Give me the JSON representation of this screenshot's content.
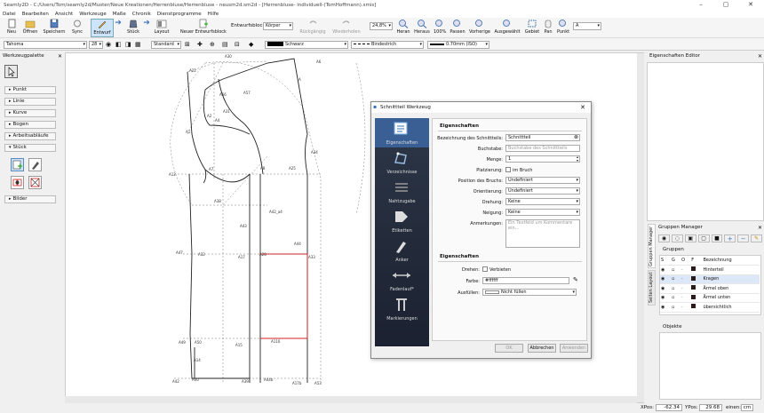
{
  "window": {
    "title": "Seamly2D - C:/Users/Tom/seamly2d/Muster/Neue Kreationen/Herrenbluse/Herrenbluse - neusm2d.sm2d - [Herrenbluse- individuell-(TomHoffmann).smis]",
    "controls": [
      "–",
      "▢",
      "✕"
    ]
  },
  "menu": [
    "Datei",
    "Bearbeiten",
    "Ansicht",
    "Werkzeuge",
    "Maße",
    "Chronik",
    "Dienstprogramme",
    "Hilfe"
  ],
  "toolbar": {
    "neu": "Neu",
    "oeffnen": "Öffnen",
    "speichern": "Speichern",
    "sync": "Sync",
    "entwurf": "Entwurf",
    "stueck": "Stück",
    "layout": "Layout",
    "neuer_entwurf": "Neuer Entwurfsblock",
    "entwurfsblock_label": "Entwurfsblock:",
    "entwurfsblock_value": "Körper",
    "rueckgaengig": "Rückgängig",
    "wiederholen": "Wiederholen",
    "zoom_value": "24,8%",
    "heran": "Heran",
    "heraus": "Heraus",
    "hundert": "100%",
    "passen": "Passen",
    "vorherige": "Vorherige",
    "ausgewaehlt": "Ausgewählt",
    "gebiet": "Gebiet",
    "pan": "Pan",
    "punkt": "Punkt",
    "punkt_value": "A"
  },
  "toolbar2": {
    "font": "Tahoma",
    "size": "28",
    "style": "Standard",
    "color": "Schwarz",
    "linetype": "Bindestrich",
    "lineweight": "0.70mm (ISO)"
  },
  "werkzeugpalette": {
    "title": "Werkzeugpalette",
    "items": [
      "Punkt",
      "Linie",
      "Kurve",
      "Bogen",
      "Arbeitsabläufe",
      "Stück"
    ],
    "bilder": "Bilder"
  },
  "eigenschaften_editor": {
    "title": "Eigenschaften Editor"
  },
  "gruppen_manager": {
    "title": "Gruppen Manager",
    "gruppen_label": "Gruppen",
    "headers": [
      "S",
      "G",
      "O",
      "F",
      "Bezeichnung"
    ],
    "rows": [
      {
        "name": "Hinterteil",
        "color": "#2a1a1a"
      },
      {
        "name": "Kragen",
        "color": "#2a1a1a"
      },
      {
        "name": "Ärmel oben",
        "color": "#2a1a1a"
      },
      {
        "name": "Ärmel unten",
        "color": "#2a1a1a"
      },
      {
        "name": "übersichtlich",
        "color": "#2a1a1a"
      }
    ],
    "objekte": "Objekte"
  },
  "side_tabs": [
    "Gruppen Manager",
    "Seiten Layout"
  ],
  "statusbar": {
    "xpos_label": "XPos:",
    "xpos": "-62.34",
    "ypos_label": "YPos:",
    "ypos": "29.68",
    "unit_label": "einen:",
    "unit": "cm"
  },
  "dialog": {
    "title": "Schnittteil Werkzeug",
    "nav": [
      "Eigenschaften",
      "Verzeichnisse",
      "Nahtzugabe",
      "Etiketten",
      "Anker",
      "Fadenlauf*",
      "Markierungen"
    ],
    "section1": "Eigenschaften",
    "fields": {
      "bezeichnung_label": "Bezeichnung des Schnittteils:",
      "bezeichnung": "Schnittteil",
      "buchstabe_label": "Buchstabe:",
      "buchstabe_placeholder": "Buchstabe des Schnittteils",
      "menge_label": "Menge:",
      "menge": "1",
      "platzierung_label": "Platzierung:",
      "platzierung": "im Bruch",
      "bruch_label": "Position des Bruchs:",
      "bruch": "Undefiniert",
      "orientierung_label": "Orientierung:",
      "orientierung": "Undefiniert",
      "drehung_label": "Drehung:",
      "drehung": "Keine",
      "neigung_label": "Neigung:",
      "neigung": "Keine",
      "anmerkungen_label": "Anmerkungen:",
      "anmerkungen_placeholder": "Ein Textfeld um Kommentare ein..."
    },
    "section2": "Eigenschaften",
    "fields2": {
      "drehen_label": "Drehen:",
      "drehen": "Verbieten",
      "farbe_label": "Farbe:",
      "farbe": "#ffffff",
      "ausfuellen_label": "Ausfüllen:",
      "ausfuellen": "Nicht füllen"
    },
    "buttons": {
      "ok": "OK",
      "abbrechen": "Abbrechen",
      "anwenden": "Anwenden"
    }
  },
  "pattern_labels": [
    "A30",
    "A6",
    "A22",
    "A56",
    "A57",
    "A31",
    "A",
    "A2",
    "A4",
    "A34",
    "A12",
    "A7",
    "A8",
    "A25",
    "A1",
    "A38",
    "A43",
    "A42_a4",
    "A44",
    "A47",
    "A32",
    "A17",
    "A28",
    "A33",
    "A49",
    "A50",
    "A15",
    "A116",
    "A14",
    "A42",
    "A40",
    "A39",
    "A44b",
    "A17b",
    "A53"
  ],
  "colors": {
    "accent": "#3070c0",
    "dialog_sidebar": "#2d3748",
    "red_line": "#d02020"
  }
}
